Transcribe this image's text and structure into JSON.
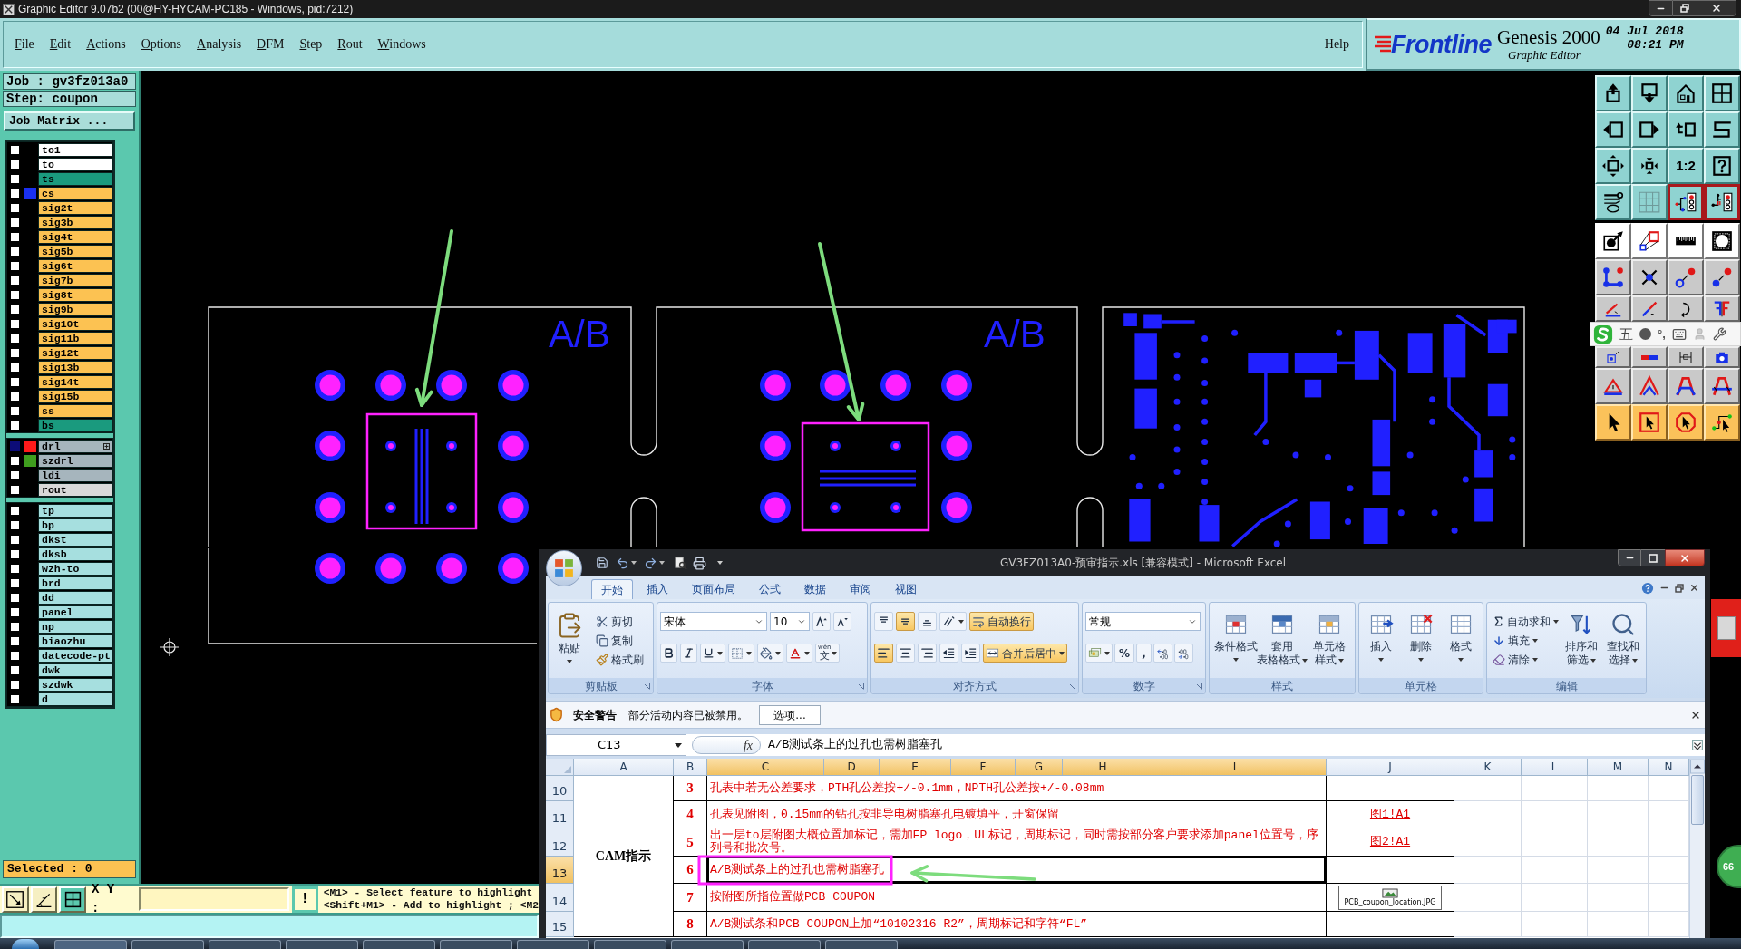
{
  "window": {
    "title": "Graphic Editor 9.07b2 (00@HY-HYCAM-PC185 - Windows, pid:7212)"
  },
  "menu": {
    "items": [
      "File",
      "Edit",
      "Actions",
      "Options",
      "Analysis",
      "DFM",
      "Step",
      "Rout",
      "Windows"
    ],
    "help": "Help"
  },
  "brand": {
    "logo": "Frontline",
    "product": "Genesis 2000",
    "subtitle": "Graphic Editor",
    "date": "04 Jul 2018",
    "time": "08:21 PM"
  },
  "job": {
    "name": "Job : gv3fz013a0",
    "step": "Step: coupon",
    "matrix_button": "Job Matrix ..."
  },
  "layer_groups": [
    [
      {
        "name": "to1",
        "color": "#ffffff",
        "checked": false,
        "work": false
      },
      {
        "name": "to",
        "color": "#ffffff",
        "checked": false,
        "work": false
      },
      {
        "name": "ts",
        "color": "#1a9a7e",
        "checked": false,
        "work": false
      },
      {
        "name": "cs",
        "color": "#fcc252",
        "swatch": {
          "color": "#1a30f0"
        },
        "checked": false,
        "work": false
      },
      {
        "name": "sig2t",
        "color": "#fcc252",
        "checked": false,
        "work": false
      },
      {
        "name": "sig3b",
        "color": "#fcc252",
        "checked": false,
        "work": false
      },
      {
        "name": "sig4t",
        "color": "#fcc252",
        "checked": false,
        "work": false
      },
      {
        "name": "sig5b",
        "color": "#fcc252",
        "checked": false,
        "work": false
      },
      {
        "name": "sig6t",
        "color": "#fcc252",
        "checked": false,
        "work": false
      },
      {
        "name": "sig7b",
        "color": "#fcc252",
        "checked": false,
        "work": false
      },
      {
        "name": "sig8t",
        "color": "#fcc252",
        "checked": false,
        "work": false
      },
      {
        "name": "sig9b",
        "color": "#fcc252",
        "checked": false,
        "work": false
      },
      {
        "name": "sig10t",
        "color": "#fcc252",
        "checked": false,
        "work": false
      },
      {
        "name": "sig11b",
        "color": "#fcc252",
        "checked": false,
        "work": false
      },
      {
        "name": "sig12t",
        "color": "#fcc252",
        "checked": false,
        "work": false
      },
      {
        "name": "sig13b",
        "color": "#fcc252",
        "checked": false,
        "work": false
      },
      {
        "name": "sig14t",
        "color": "#fcc252",
        "checked": false,
        "work": false
      },
      {
        "name": "sig15b",
        "color": "#fcc252",
        "checked": false,
        "work": false
      },
      {
        "name": "ss",
        "color": "#fcc252",
        "checked": false,
        "work": false
      },
      {
        "name": "bs",
        "color": "#1a9a7e",
        "checked": false,
        "work": false
      }
    ],
    [
      {
        "name": "drl",
        "color": "#a6b5bd",
        "swatch": {
          "color": "#ff1a1a"
        },
        "checked": true,
        "work": true
      },
      {
        "name": "szdrl",
        "color": "#a6b5bd",
        "swatch": {
          "color": "#3f9e1e"
        },
        "checked": false,
        "work": false
      },
      {
        "name": "ldi",
        "color": "#a6b5bd",
        "checked": false,
        "work": false
      },
      {
        "name": "rout",
        "color": "#d9d9d9",
        "checked": false,
        "work": false
      }
    ],
    [
      {
        "name": "tp",
        "color": "#a6dfdf",
        "checked": false,
        "work": false
      },
      {
        "name": "bp",
        "color": "#a6dfdf",
        "checked": false,
        "work": false
      },
      {
        "name": "dkst",
        "color": "#a6dfdf",
        "checked": false,
        "work": false
      },
      {
        "name": "dksb",
        "color": "#a6dfdf",
        "checked": false,
        "work": false
      },
      {
        "name": "wzh-to",
        "color": "#a6dfdf",
        "checked": false,
        "work": false
      },
      {
        "name": "brd",
        "color": "#a6dfdf",
        "checked": false,
        "work": false
      },
      {
        "name": "dd",
        "color": "#a6dfdf",
        "checked": false,
        "work": false
      },
      {
        "name": "panel",
        "color": "#a6dfdf",
        "checked": false,
        "work": false
      },
      {
        "name": "np",
        "color": "#a6dfdf",
        "checked": false,
        "work": false
      },
      {
        "name": "biaozhu",
        "color": "#a6dfdf",
        "checked": false,
        "work": false
      },
      {
        "name": "datecode-pt",
        "color": "#a6dfdf",
        "checked": false,
        "work": false
      },
      {
        "name": "dwk",
        "color": "#a6dfdf",
        "checked": false,
        "work": false
      },
      {
        "name": "szdwk",
        "color": "#a6dfdf",
        "checked": false,
        "work": false
      },
      {
        "name": "d",
        "color": "#a6dfdf",
        "checked": false,
        "work": false
      }
    ]
  ],
  "selected_count": "Selected : 0",
  "canvas": {
    "coupon_labels": [
      "A/B",
      "A/B"
    ]
  },
  "toolbar": {
    "ratio_button": "1:2"
  },
  "ime_bar": {
    "mode": "五",
    "punctuation": "°,"
  },
  "bottom_bar": {
    "tools": [
      {
        "selected": false
      },
      {
        "selected": false
      },
      {
        "selected": true
      }
    ],
    "coordinates_label": "X Y :",
    "action_button": "!",
    "hints": [
      "<M1> - Select feature to highlight",
      "<Shift+M1> - Add to highlight ; <M2"
    ]
  },
  "side_widget": {
    "badge": "66"
  },
  "excel": {
    "title": "GV3FZ013A0-预审指示.xls [兼容模式] - Microsoft Excel",
    "tabs": [
      {
        "label": "开始",
        "selected": true
      },
      {
        "label": "插入",
        "selected": false
      },
      {
        "label": "页面布局",
        "selected": false
      },
      {
        "label": "公式",
        "selected": false
      },
      {
        "label": "数据",
        "selected": false
      },
      {
        "label": "审阅",
        "selected": false
      },
      {
        "label": "视图",
        "selected": false
      }
    ],
    "ribbon": {
      "clipboard": {
        "label": "剪贴板",
        "paste": "粘贴",
        "cut": "剪切",
        "copy": "复制",
        "format_painter": "格式刷"
      },
      "font": {
        "label": "字体",
        "name": "宋体",
        "size": "10",
        "phonetic": "文",
        "phonetic_hint": "wén"
      },
      "alignment": {
        "label": "对齐方式",
        "vertical": [
          {
            "selected": false
          },
          {
            "selected": true
          },
          {
            "selected": false
          }
        ],
        "horizontal": [
          {
            "selected": true
          },
          {
            "selected": false
          },
          {
            "selected": false
          }
        ],
        "wrap": {
          "label": "自动换行",
          "on": true
        },
        "merge": {
          "label": "合并后居中",
          "on": true
        }
      },
      "number": {
        "label": "数字",
        "format": "常规",
        "percent": "%",
        "comma": ","
      },
      "styles": {
        "label": "样式",
        "buttons": [
          [
            "条件格式"
          ],
          [
            "套用",
            "表格格式"
          ],
          [
            "单元格",
            "样式"
          ]
        ]
      },
      "cells": {
        "label": "单元格",
        "buttons": [
          "插入",
          "删除",
          "格式"
        ]
      },
      "editing": {
        "label": "编辑",
        "autosum": "自动求和",
        "fill": "填充",
        "clear": "清除",
        "sort": [
          "排序和",
          "筛选"
        ],
        "find": [
          "查找和",
          "选择"
        ]
      }
    },
    "security": {
      "title": "安全警告",
      "message": "部分活动内容已被禁用。",
      "button": "选项..."
    },
    "formula_bar": {
      "cell": "C13",
      "function_label": "fx",
      "value": "A/B测试条上的过孔也需树脂塞孔"
    },
    "columns": [
      {
        "label": "A",
        "selected": false
      },
      {
        "label": "B",
        "selected": false
      },
      {
        "label": "C",
        "selected": true
      },
      {
        "label": "D",
        "selected": true
      },
      {
        "label": "E",
        "selected": true
      },
      {
        "label": "F",
        "selected": true
      },
      {
        "label": "G",
        "selected": true
      },
      {
        "label": "H",
        "selected": true
      },
      {
        "label": "I",
        "selected": true
      },
      {
        "label": "J",
        "selected": false
      },
      {
        "label": "K",
        "selected": false
      },
      {
        "label": "L",
        "selected": false
      },
      {
        "label": "M",
        "selected": false
      },
      {
        "label": "N",
        "selected": false
      }
    ],
    "section": "CAM指示",
    "rows": [
      {
        "number": "10",
        "selected": false,
        "item": "3",
        "text": "孔表中若无公差要求，PTH孔公差按+/-0.1mm，NPTH孔公差按+/-0.08mm"
      },
      {
        "number": "11",
        "selected": false,
        "item": "4",
        "text": "孔表见附图，0.15mm的钻孔按非导电树脂塞孔电镀填平，开窗保留",
        "link": "图1!A1"
      },
      {
        "number": "12",
        "selected": false,
        "item": "5",
        "text": "出一层to层附图大概位置加标记，需加FP logo，UL标记，周期标记，同时需按部分客户要求添加panel位置号，序列号和批次号。",
        "link": "图2!A1"
      },
      {
        "number": "13",
        "selected": true,
        "item": "6",
        "text": "A/B测试条上的过孔也需树脂塞孔"
      },
      {
        "number": "14",
        "selected": false,
        "item": "7",
        "text": "按附图所指位置做PCB COUPON",
        "attachment": "PCB_coupon_location.JPG"
      },
      {
        "number": "15",
        "selected": false,
        "item": "8",
        "text": "A/B测试条和PCB COUPON上加“10102316 R2”，周期标记和字符“FL”"
      }
    ]
  }
}
